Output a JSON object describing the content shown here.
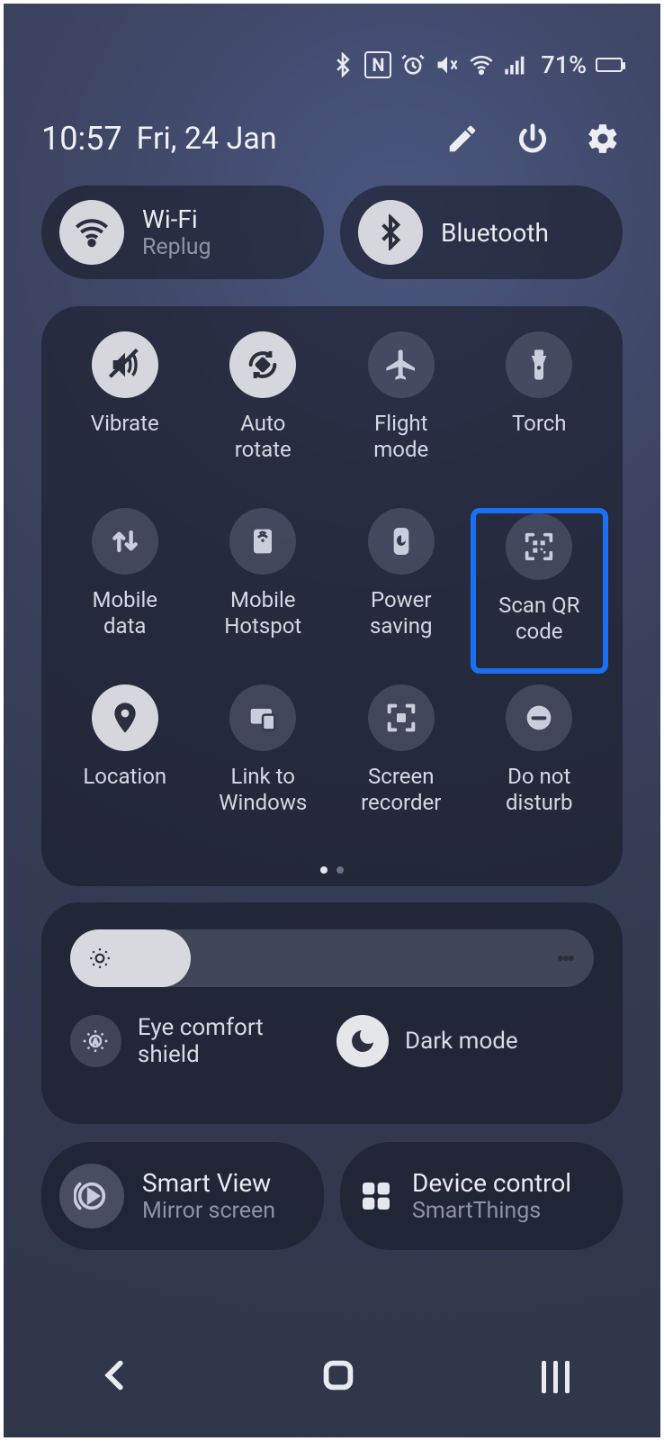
{
  "status": {
    "battery": "71%"
  },
  "header": {
    "time": "10:57",
    "date": "Fri, 24 Jan"
  },
  "pills": {
    "wifi": {
      "title": "Wi-Fi",
      "subtitle": "Replug"
    },
    "bt": {
      "title": "Bluetooth"
    }
  },
  "tiles": [
    {
      "id": "vibrate",
      "label": "Vibrate",
      "on": true
    },
    {
      "id": "autorotate",
      "label": "Auto\nrotate",
      "on": true
    },
    {
      "id": "flightmode",
      "label": "Flight\nmode",
      "on": false
    },
    {
      "id": "torch",
      "label": "Torch",
      "on": false
    },
    {
      "id": "mobiledata",
      "label": "Mobile\ndata",
      "on": false
    },
    {
      "id": "hotspot",
      "label": "Mobile\nHotspot",
      "on": false
    },
    {
      "id": "powersave",
      "label": "Power\nsaving",
      "on": false
    },
    {
      "id": "scanqr",
      "label": "Scan QR\ncode",
      "on": false,
      "highlight": true
    },
    {
      "id": "location",
      "label": "Location",
      "on": true
    },
    {
      "id": "linkwindows",
      "label": "Link to\nWindows",
      "on": false
    },
    {
      "id": "screenrec",
      "label": "Screen\nrecorder",
      "on": false
    },
    {
      "id": "dnd",
      "label": "Do not\ndisturb",
      "on": false
    }
  ],
  "brightness": {
    "eye": "Eye comfort shield",
    "dark": "Dark mode"
  },
  "bottom": {
    "smartview": {
      "title": "Smart View",
      "subtitle": "Mirror screen"
    },
    "devctrl": {
      "title": "Device control",
      "subtitle": "SmartThings"
    }
  }
}
